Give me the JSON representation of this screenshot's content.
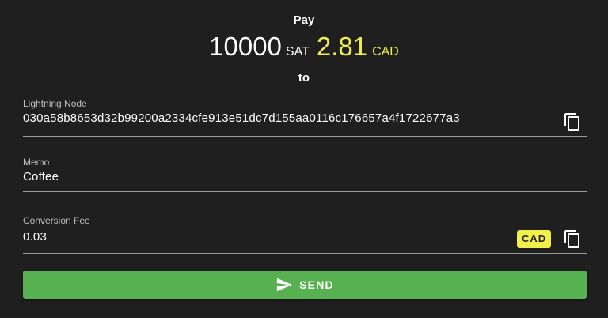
{
  "header": {
    "pay_label": "Pay",
    "amount_sat": "10000",
    "unit_sat": "SAT",
    "amount_fiat": "2.81",
    "unit_fiat": "CAD",
    "to_label": "to"
  },
  "fields": {
    "node": {
      "label": "Lightning Node",
      "value": "030a58b8653d32b99200a2334cfe913e51dc7d155aa0116c176657a4f1722677a3"
    },
    "memo": {
      "label": "Memo",
      "value": "Coffee"
    },
    "fee": {
      "label": "Conversion Fee",
      "value": "0.03",
      "currency_badge": "CAD"
    }
  },
  "send_button": {
    "label": "SEND",
    "icon": "send-icon"
  },
  "colors": {
    "background": "#1f1f1f",
    "accent_yellow": "#f3ef4a",
    "send_green": "#58b150"
  },
  "icons": {
    "copy": "copy-icon",
    "send": "send-icon"
  }
}
